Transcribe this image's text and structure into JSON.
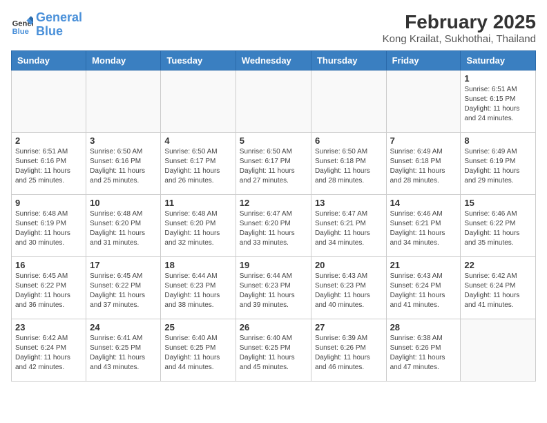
{
  "logo": {
    "line1": "General",
    "line2": "Blue"
  },
  "title": "February 2025",
  "subtitle": "Kong Krailat, Sukhothai, Thailand",
  "weekdays": [
    "Sunday",
    "Monday",
    "Tuesday",
    "Wednesday",
    "Thursday",
    "Friday",
    "Saturday"
  ],
  "weeks": [
    [
      {
        "day": "",
        "info": ""
      },
      {
        "day": "",
        "info": ""
      },
      {
        "day": "",
        "info": ""
      },
      {
        "day": "",
        "info": ""
      },
      {
        "day": "",
        "info": ""
      },
      {
        "day": "",
        "info": ""
      },
      {
        "day": "1",
        "info": "Sunrise: 6:51 AM\nSunset: 6:15 PM\nDaylight: 11 hours and 24 minutes."
      }
    ],
    [
      {
        "day": "2",
        "info": "Sunrise: 6:51 AM\nSunset: 6:16 PM\nDaylight: 11 hours and 25 minutes."
      },
      {
        "day": "3",
        "info": "Sunrise: 6:50 AM\nSunset: 6:16 PM\nDaylight: 11 hours and 25 minutes."
      },
      {
        "day": "4",
        "info": "Sunrise: 6:50 AM\nSunset: 6:17 PM\nDaylight: 11 hours and 26 minutes."
      },
      {
        "day": "5",
        "info": "Sunrise: 6:50 AM\nSunset: 6:17 PM\nDaylight: 11 hours and 27 minutes."
      },
      {
        "day": "6",
        "info": "Sunrise: 6:50 AM\nSunset: 6:18 PM\nDaylight: 11 hours and 28 minutes."
      },
      {
        "day": "7",
        "info": "Sunrise: 6:49 AM\nSunset: 6:18 PM\nDaylight: 11 hours and 28 minutes."
      },
      {
        "day": "8",
        "info": "Sunrise: 6:49 AM\nSunset: 6:19 PM\nDaylight: 11 hours and 29 minutes."
      }
    ],
    [
      {
        "day": "9",
        "info": "Sunrise: 6:48 AM\nSunset: 6:19 PM\nDaylight: 11 hours and 30 minutes."
      },
      {
        "day": "10",
        "info": "Sunrise: 6:48 AM\nSunset: 6:20 PM\nDaylight: 11 hours and 31 minutes."
      },
      {
        "day": "11",
        "info": "Sunrise: 6:48 AM\nSunset: 6:20 PM\nDaylight: 11 hours and 32 minutes."
      },
      {
        "day": "12",
        "info": "Sunrise: 6:47 AM\nSunset: 6:20 PM\nDaylight: 11 hours and 33 minutes."
      },
      {
        "day": "13",
        "info": "Sunrise: 6:47 AM\nSunset: 6:21 PM\nDaylight: 11 hours and 34 minutes."
      },
      {
        "day": "14",
        "info": "Sunrise: 6:46 AM\nSunset: 6:21 PM\nDaylight: 11 hours and 34 minutes."
      },
      {
        "day": "15",
        "info": "Sunrise: 6:46 AM\nSunset: 6:22 PM\nDaylight: 11 hours and 35 minutes."
      }
    ],
    [
      {
        "day": "16",
        "info": "Sunrise: 6:45 AM\nSunset: 6:22 PM\nDaylight: 11 hours and 36 minutes."
      },
      {
        "day": "17",
        "info": "Sunrise: 6:45 AM\nSunset: 6:22 PM\nDaylight: 11 hours and 37 minutes."
      },
      {
        "day": "18",
        "info": "Sunrise: 6:44 AM\nSunset: 6:23 PM\nDaylight: 11 hours and 38 minutes."
      },
      {
        "day": "19",
        "info": "Sunrise: 6:44 AM\nSunset: 6:23 PM\nDaylight: 11 hours and 39 minutes."
      },
      {
        "day": "20",
        "info": "Sunrise: 6:43 AM\nSunset: 6:23 PM\nDaylight: 11 hours and 40 minutes."
      },
      {
        "day": "21",
        "info": "Sunrise: 6:43 AM\nSunset: 6:24 PM\nDaylight: 11 hours and 41 minutes."
      },
      {
        "day": "22",
        "info": "Sunrise: 6:42 AM\nSunset: 6:24 PM\nDaylight: 11 hours and 41 minutes."
      }
    ],
    [
      {
        "day": "23",
        "info": "Sunrise: 6:42 AM\nSunset: 6:24 PM\nDaylight: 11 hours and 42 minutes."
      },
      {
        "day": "24",
        "info": "Sunrise: 6:41 AM\nSunset: 6:25 PM\nDaylight: 11 hours and 43 minutes."
      },
      {
        "day": "25",
        "info": "Sunrise: 6:40 AM\nSunset: 6:25 PM\nDaylight: 11 hours and 44 minutes."
      },
      {
        "day": "26",
        "info": "Sunrise: 6:40 AM\nSunset: 6:25 PM\nDaylight: 11 hours and 45 minutes."
      },
      {
        "day": "27",
        "info": "Sunrise: 6:39 AM\nSunset: 6:26 PM\nDaylight: 11 hours and 46 minutes."
      },
      {
        "day": "28",
        "info": "Sunrise: 6:38 AM\nSunset: 6:26 PM\nDaylight: 11 hours and 47 minutes."
      },
      {
        "day": "",
        "info": ""
      }
    ]
  ]
}
